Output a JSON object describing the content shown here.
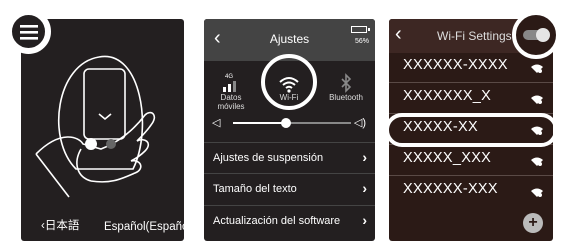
{
  "panel1": {
    "menu_icon": "hamburger-menu-icon",
    "device_illustration": "hand-pressing-device-button",
    "lang_prev": "‹日本語",
    "lang_next": "Español(Español)"
  },
  "panel2": {
    "title": "Ajustes",
    "battery_text": "56%",
    "quick": [
      {
        "label": "Datos móviles",
        "icon": "signal-4g-icon"
      },
      {
        "label": "Wi-Fi",
        "icon": "wifi-icon"
      },
      {
        "label": "Bluetooth",
        "icon": "bluetooth-icon"
      }
    ],
    "volume_level": 0.45,
    "menu": [
      "Ajustes de suspensión",
      "Tamaño del texto",
      "Actualización del software"
    ]
  },
  "panel3": {
    "title": "Wi-Fi Settings",
    "toggle_on": true,
    "networks": [
      "XXXXXX-XXXX",
      "XXXXXXX_X",
      "XXXXX-XX",
      "XXXXX_XXX",
      "XXXXXX-XXX"
    ],
    "add_label": "+"
  }
}
